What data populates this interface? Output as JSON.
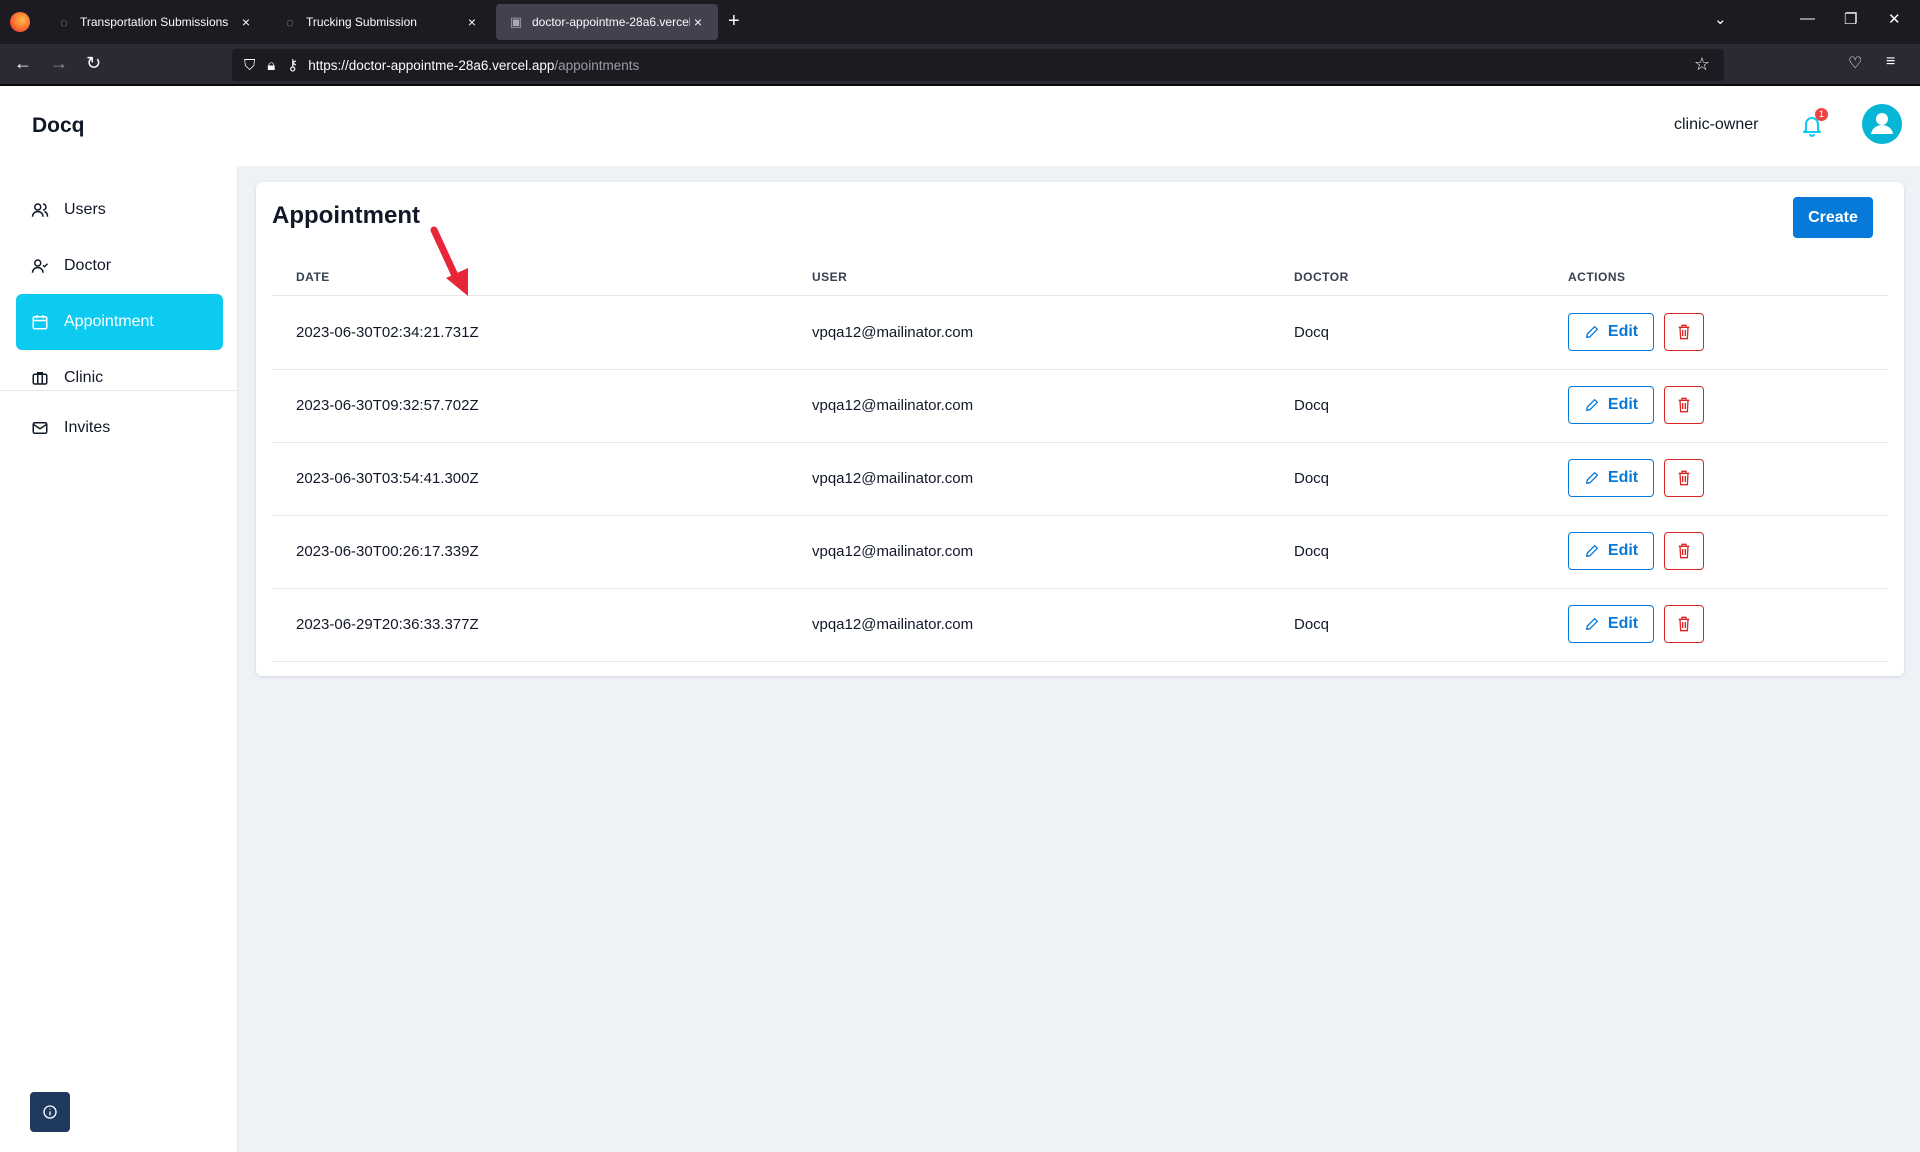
{
  "browser": {
    "tabs": [
      {
        "title": "Transportation Submissions",
        "close": "×"
      },
      {
        "title": "Trucking Submission",
        "close": "×"
      },
      {
        "title": "doctor-appointme-28a6.vercel.app",
        "close": "×"
      }
    ],
    "new_tab": "+",
    "url_host": "https://doctor-appointme-28a6.vercel.app",
    "url_path": "/appointments"
  },
  "app": {
    "brand": "Docq",
    "username": "clinic-owner",
    "notification_count": "1"
  },
  "sidebar": {
    "items": [
      {
        "label": "Users",
        "icon": "users-icon"
      },
      {
        "label": "Doctor",
        "icon": "doctor-icon"
      },
      {
        "label": "Appointment",
        "icon": "calendar-icon"
      },
      {
        "label": "Clinic",
        "icon": "briefcase-icon"
      },
      {
        "label": "Invites",
        "icon": "mail-icon"
      }
    ],
    "active": "Appointment"
  },
  "main": {
    "title": "Appointment",
    "create_label": "Create",
    "columns": [
      "DATE",
      "USER",
      "DOCTOR",
      "ACTIONS"
    ],
    "rows": [
      {
        "date": "2023-06-30T02:34:21.731Z",
        "user": "vpqa12@mailinator.com",
        "doctor": "Docq"
      },
      {
        "date": "2023-06-30T09:32:57.702Z",
        "user": "vpqa12@mailinator.com",
        "doctor": "Docq"
      },
      {
        "date": "2023-06-30T03:54:41.300Z",
        "user": "vpqa12@mailinator.com",
        "doctor": "Docq"
      },
      {
        "date": "2023-06-30T00:26:17.339Z",
        "user": "vpqa12@mailinator.com",
        "doctor": "Docq"
      },
      {
        "date": "2023-06-29T20:36:33.377Z",
        "user": "vpqa12@mailinator.com",
        "doctor": "Docq"
      }
    ],
    "edit_label": "Edit"
  },
  "colors": {
    "accent": "#0779d8",
    "sidebar_active": "#0ccaf0",
    "danger": "#dc2626",
    "annotation_arrow": "#e8263a"
  }
}
